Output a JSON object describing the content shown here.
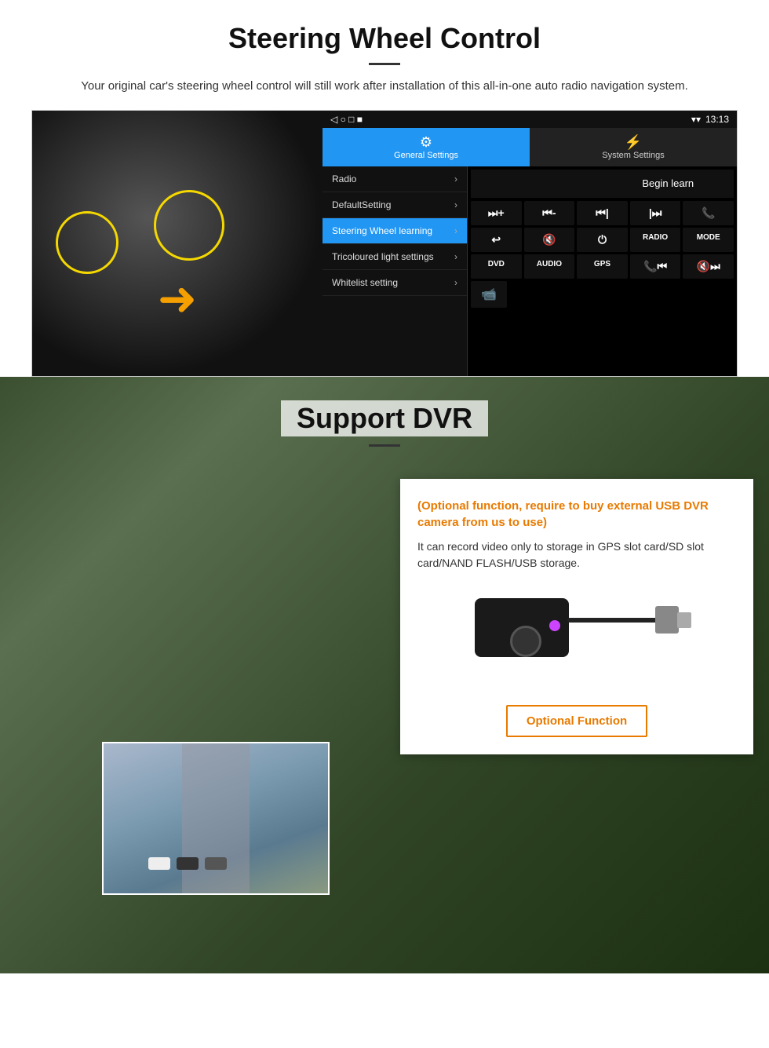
{
  "swc": {
    "title": "Steering Wheel Control",
    "description": "Your original car's steering wheel control will still work after installation of this all-in-one auto radio navigation system.",
    "statusbar": {
      "time": "13:13",
      "icons": "▾ ▾"
    },
    "tabs": {
      "general": "General Settings",
      "system": "System Settings"
    },
    "menu_items": [
      {
        "label": "Radio",
        "active": false
      },
      {
        "label": "DefaultSetting",
        "active": false
      },
      {
        "label": "Steering Wheel learning",
        "active": true
      },
      {
        "label": "Tricoloured light settings",
        "active": false
      },
      {
        "label": "Whitelist setting",
        "active": false
      }
    ],
    "begin_learn": "Begin learn",
    "controls_row1": [
      "⏮+",
      "⏮-",
      "⏮|",
      "|⏭",
      "📞"
    ],
    "controls_row2": [
      "↩",
      "🔇",
      "⏻",
      "RADIO",
      "MODE"
    ],
    "controls_row3": [
      "DVD",
      "AUDIO",
      "GPS",
      "📞⏮|",
      "🔇⏭"
    ],
    "controls_row4": [
      "📹"
    ]
  },
  "dvr": {
    "title": "Support DVR",
    "optional_text": "(Optional function, require to buy external USB DVR camera from us to use)",
    "description": "It can record video only to storage in GPS slot card/SD slot card/NAND FLASH/USB storage.",
    "optional_button_label": "Optional Function"
  }
}
